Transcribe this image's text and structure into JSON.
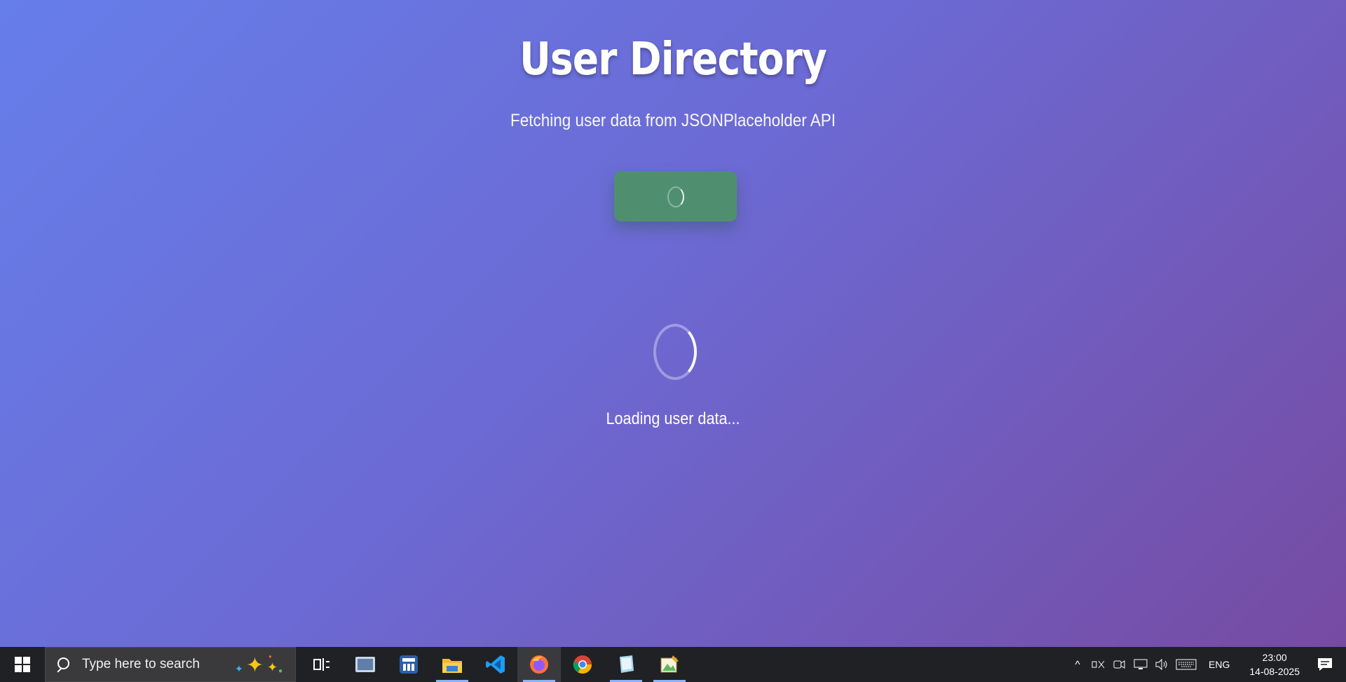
{
  "page": {
    "title": "User Directory",
    "subtitle": "Fetching user data from JSONPlaceholder API",
    "loading_text": "Loading user data..."
  },
  "colors": {
    "bg_gradient_start": "#667eea",
    "bg_gradient_end": "#764ba2",
    "button": "#4f8f70",
    "taskbar": "#202124"
  },
  "taskbar": {
    "search_placeholder": "Type here to search",
    "apps": [
      {
        "name": "task-view-icon"
      },
      {
        "name": "window-app-icon"
      },
      {
        "name": "calculator-app-icon"
      },
      {
        "name": "file-explorer-icon"
      },
      {
        "name": "vscode-icon"
      },
      {
        "name": "firefox-icon"
      },
      {
        "name": "chrome-icon"
      },
      {
        "name": "notebook-app-icon"
      },
      {
        "name": "image-editor-icon"
      }
    ],
    "language": "ENG",
    "time": "23:00",
    "date": "14-08-2025"
  }
}
